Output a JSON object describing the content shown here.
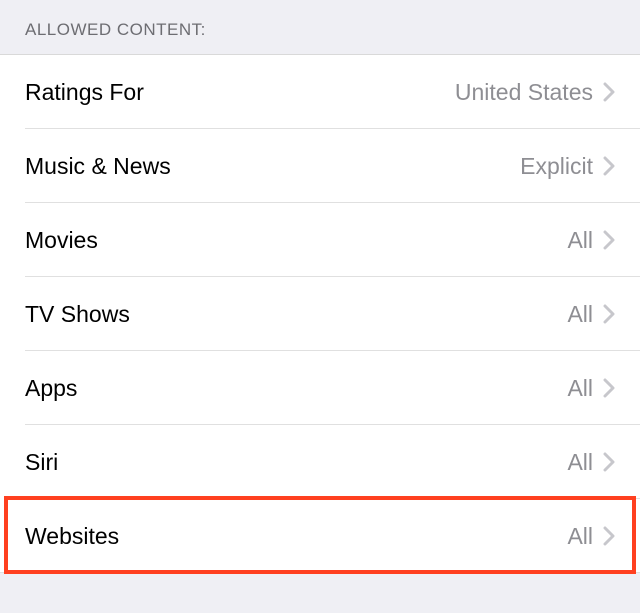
{
  "sectionHeader": "Allowed Content:",
  "rows": [
    {
      "label": "Ratings For",
      "value": "United States"
    },
    {
      "label": "Music & News",
      "value": "Explicit"
    },
    {
      "label": "Movies",
      "value": "All"
    },
    {
      "label": "TV Shows",
      "value": "All"
    },
    {
      "label": "Apps",
      "value": "All"
    },
    {
      "label": "Siri",
      "value": "All"
    },
    {
      "label": "Websites",
      "value": "All"
    }
  ],
  "highlightIndex": 6
}
